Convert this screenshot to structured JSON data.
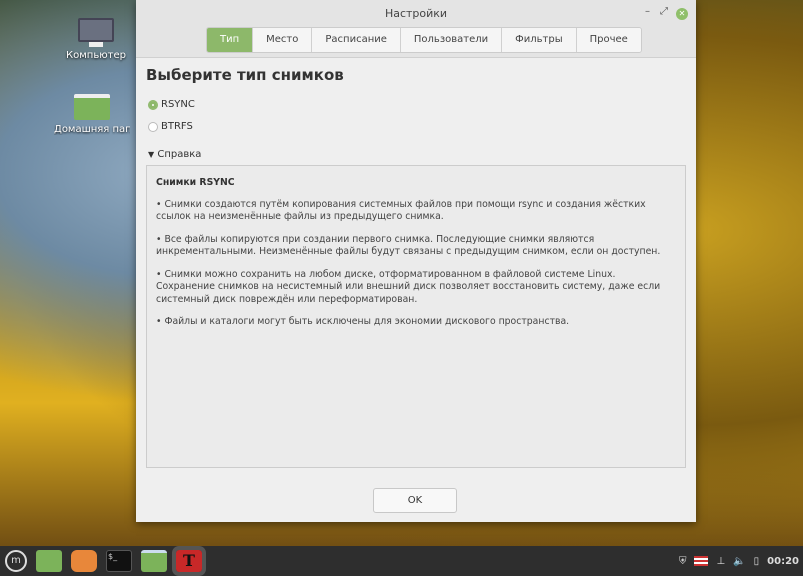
{
  "desktop": {
    "icons": [
      {
        "label": "Компьютер"
      },
      {
        "label": "Домашняя папка"
      }
    ]
  },
  "window": {
    "title": "Настройки",
    "tabs": [
      "Тип",
      "Место",
      "Расписание",
      "Пользователи",
      "Фильтры",
      "Прочее"
    ],
    "active_tab": "Тип",
    "heading": "Выберите тип снимков",
    "options": [
      {
        "label": "RSYNC",
        "selected": true
      },
      {
        "label": "BTRFS",
        "selected": false
      }
    ],
    "expander": "Справка",
    "help": {
      "title": "Снимки RSYNC",
      "paragraphs": [
        "• Снимки создаются путём копирования системных файлов при помощи rsync и создания жёстких ссылок на неизменённые файлы из предыдущего снимка.",
        "• Все файлы копируются при создании первого снимка. Последующие снимки являются инкрементальными. Неизменённые файлы будут связаны с предыдущим снимком, если он доступен.",
        "• Снимки можно сохранить на любом диске, отформатированном в файловой системе Linux. Сохранение снимков на несистемный или внешний диск позволяет восстановить систему, даже если системный диск повреждён или переформатирован.",
        "• Файлы и каталоги могут быть исключены для экономии дискового пространства."
      ]
    },
    "ok_label": "OK"
  },
  "taskbar": {
    "clock": "00:20",
    "accent": "#8db86a"
  }
}
